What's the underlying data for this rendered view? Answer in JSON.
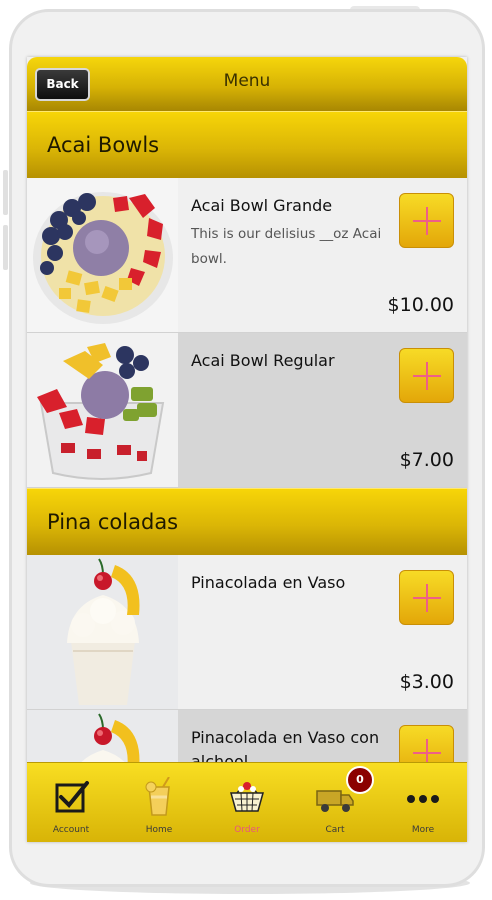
{
  "header": {
    "back_label": "Back",
    "title": "Menu"
  },
  "sections": [
    {
      "title": "Acai Bowls",
      "items": [
        {
          "name": "Acai Bowl Grande",
          "description": "This is our delisius __oz Acai bowl.",
          "price": "$10.00",
          "thumb_icon": "acai-bowl-grande-photo"
        },
        {
          "name": "Acai Bowl Regular",
          "description": "",
          "price": "$7.00",
          "thumb_icon": "acai-bowl-regular-photo"
        }
      ]
    },
    {
      "title": "Pina coladas",
      "items": [
        {
          "name": "Pinacolada en Vaso",
          "description": "",
          "price": "$3.00",
          "thumb_icon": "pinacolada-photo"
        },
        {
          "name": "Pinacolada en Vaso con alchool",
          "description": "",
          "price": "",
          "thumb_icon": "pinacolada-alcohol-photo"
        }
      ]
    }
  ],
  "tabbar": {
    "tabs": [
      {
        "label": "Account",
        "icon": "checkbox-icon",
        "active": false
      },
      {
        "label": "Home",
        "icon": "drink-icon",
        "active": false
      },
      {
        "label": "Order",
        "icon": "basket-icon",
        "active": true
      },
      {
        "label": "Cart",
        "icon": "truck-icon",
        "active": false
      },
      {
        "label": "More",
        "icon": "more-dots-icon",
        "active": false
      }
    ],
    "cart_count": "0"
  },
  "colors": {
    "accent_yellow": "#f7d508",
    "plus_pink": "#ee5f88",
    "badge_red": "#8b0000"
  }
}
